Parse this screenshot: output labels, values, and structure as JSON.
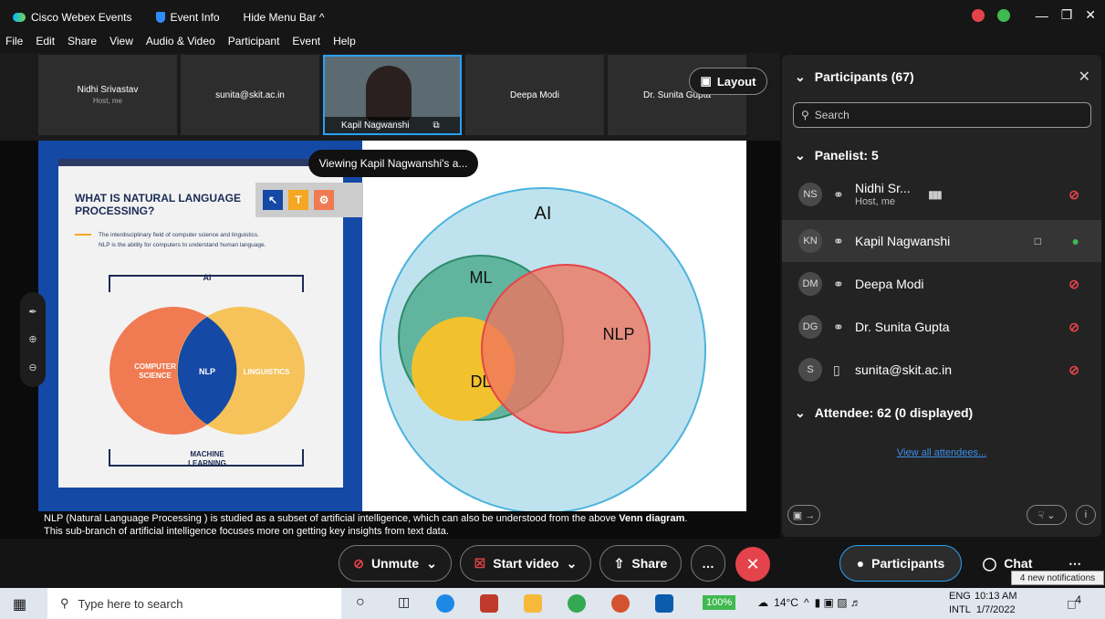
{
  "titlebar": {
    "app_name": "Cisco Webex Events",
    "event_info": "Event Info",
    "hide_menu": "Hide Menu Bar ^"
  },
  "menu": [
    "File",
    "Edit",
    "Share",
    "View",
    "Audio & Video",
    "Participant",
    "Event",
    "Help"
  ],
  "video_strip": {
    "tiles": [
      {
        "name": "Nidhi Srivastav",
        "sub": "Host, me"
      },
      {
        "name": "sunita@skit.ac.in",
        "sub": ""
      },
      {
        "name": "Kapil Nagwanshi",
        "sub": ""
      },
      {
        "name": "Deepa Modi",
        "sub": ""
      },
      {
        "name": "Dr. Sunita Gupta",
        "sub": ""
      }
    ],
    "layout_label": "Layout"
  },
  "share": {
    "viewing_label": "Viewing Kapil Nagwanshi's a...",
    "card_title": "WHAT IS NATURAL LANGUAGE PROCESSING?",
    "card_desc_1": "The interdisciplinary field of computer science and linguistics.",
    "card_desc_2": "NLP is the ability for computers to understand human language.",
    "venn_left": {
      "ai": "AI",
      "cs_1": "COMPUTER",
      "cs_2": "SCIENCE",
      "nlp": "NLP",
      "ling": "LINGUISTICS",
      "ml_1": "MACHINE",
      "ml_2": "LEARNING"
    },
    "venn_right": {
      "ai": "AI",
      "ml": "ML",
      "dl": "DL",
      "nlp": "NLP"
    },
    "caption_line1_pre": "NLP (Natural Language Processing ) is studied as a subset of artificial intelligence, which can also be understood from the above ",
    "caption_line1_bold": "Venn diagram",
    "caption_line1_post": ".",
    "caption_line2": "This sub-branch of artificial intelligence focuses more on getting key insights from text data."
  },
  "panel": {
    "title": "Participants (67)",
    "search_placeholder": "Search",
    "panelist_header": "Panelist: 5",
    "attendee_header": "Attendee: 62 (0 displayed)",
    "view_all": "View all attendees...",
    "panelists": [
      {
        "initials": "NS",
        "name": "Nidhi Sr...",
        "sub": "Host, me"
      },
      {
        "initials": "KN",
        "name": "Kapil Nagwanshi",
        "sub": ""
      },
      {
        "initials": "DM",
        "name": "Deepa Modi",
        "sub": ""
      },
      {
        "initials": "DG",
        "name": "Dr. Sunita Gupta",
        "sub": ""
      },
      {
        "initials": "S",
        "name": "sunita@skit.ac.in",
        "sub": ""
      }
    ]
  },
  "controls": {
    "unmute": "Unmute",
    "start_video": "Start video",
    "share": "Share",
    "participants": "Participants",
    "chat": "Chat",
    "notification": "4 new notifications"
  },
  "taskbar": {
    "search_placeholder": "Type here to search",
    "battery": "100%",
    "temperature": "14°C",
    "lang_1": "ENG",
    "lang_2": "INTL",
    "time": "10:13 AM",
    "date": "1/7/2022",
    "badge": "4"
  },
  "colors": {
    "accent_blue": "#2aa1f5",
    "mute_red": "#e5434b",
    "mic_green": "#3fb950",
    "slide_blue": "#1549a6"
  }
}
